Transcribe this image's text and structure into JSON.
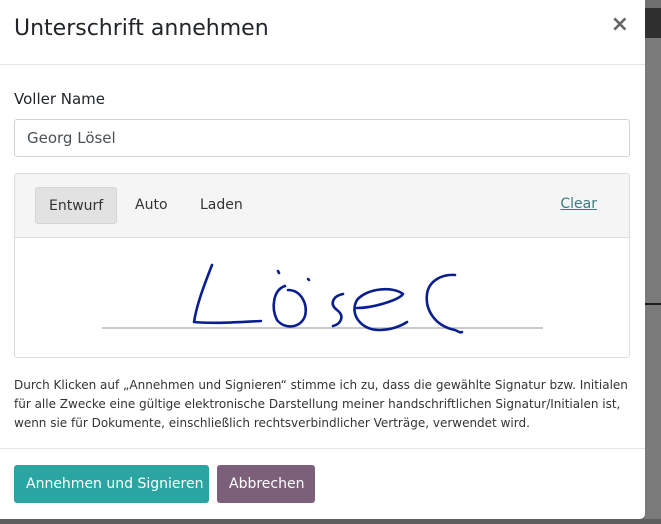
{
  "modal": {
    "title": "Unterschrift annehmen",
    "close_symbol": "×"
  },
  "name_field": {
    "label": "Voller Name",
    "value": "Georg Lösel"
  },
  "signature": {
    "tabs": [
      {
        "label": "Entwurf",
        "active": true
      },
      {
        "label": "Auto",
        "active": false
      },
      {
        "label": "Laden",
        "active": false
      }
    ],
    "clear_label": "Clear",
    "ink_color": "#0a1f8f"
  },
  "legal_text": "Durch Klicken auf „Annehmen und Signieren“ stimme ich zu, dass die gewählte Signatur bzw. Initialen für alle Zwecke eine gültige elektronische Darstellung meiner handschriftlichen Signatur/Initialen ist, wenn sie für Dokumente, einschließlich rechtsverbindlicher Verträge, verwendet wird.",
  "footer": {
    "accept_label": "Annehmen und Signieren",
    "cancel_label": "Abbrechen"
  },
  "colors": {
    "primary": "#2ba5a2",
    "secondary": "#7c607a",
    "link": "#3a7c7c"
  }
}
